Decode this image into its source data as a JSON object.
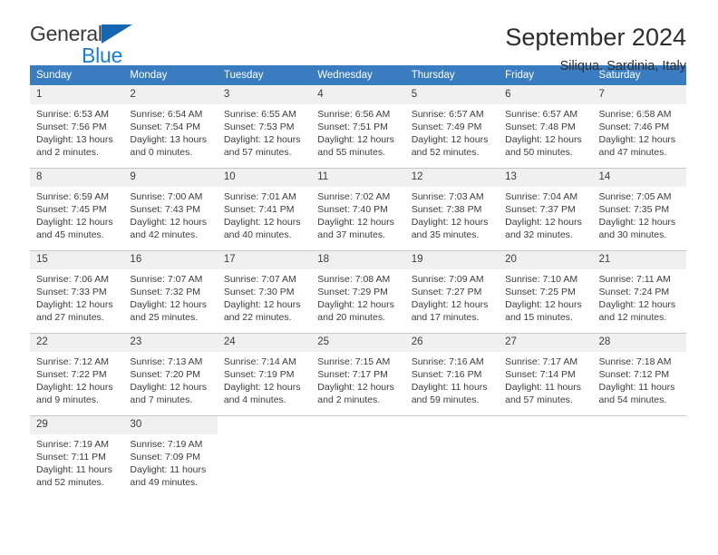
{
  "brand": {
    "name_part1": "General",
    "name_part2": "Blue",
    "triangle_color": "#1466b0",
    "blue_color": "#1a7fd4"
  },
  "header": {
    "title": "September 2024",
    "subtitle": "Siliqua, Sardinia, Italy"
  },
  "theme": {
    "header_bg": "#3a7cc0",
    "header_text": "#ffffff",
    "daynum_bg": "#f0f0f0",
    "cell_bg": "#ffffff",
    "row_border": "#c8c8c8",
    "text": "#3c3c3c"
  },
  "weekdays": [
    "Sunday",
    "Monday",
    "Tuesday",
    "Wednesday",
    "Thursday",
    "Friday",
    "Saturday"
  ],
  "weeks": [
    [
      {
        "day": "1",
        "sunrise": "Sunrise: 6:53 AM",
        "sunset": "Sunset: 7:56 PM",
        "daylight_line1": "Daylight: 13 hours",
        "daylight_line2": "and 2 minutes."
      },
      {
        "day": "2",
        "sunrise": "Sunrise: 6:54 AM",
        "sunset": "Sunset: 7:54 PM",
        "daylight_line1": "Daylight: 13 hours",
        "daylight_line2": "and 0 minutes."
      },
      {
        "day": "3",
        "sunrise": "Sunrise: 6:55 AM",
        "sunset": "Sunset: 7:53 PM",
        "daylight_line1": "Daylight: 12 hours",
        "daylight_line2": "and 57 minutes."
      },
      {
        "day": "4",
        "sunrise": "Sunrise: 6:56 AM",
        "sunset": "Sunset: 7:51 PM",
        "daylight_line1": "Daylight: 12 hours",
        "daylight_line2": "and 55 minutes."
      },
      {
        "day": "5",
        "sunrise": "Sunrise: 6:57 AM",
        "sunset": "Sunset: 7:49 PM",
        "daylight_line1": "Daylight: 12 hours",
        "daylight_line2": "and 52 minutes."
      },
      {
        "day": "6",
        "sunrise": "Sunrise: 6:57 AM",
        "sunset": "Sunset: 7:48 PM",
        "daylight_line1": "Daylight: 12 hours",
        "daylight_line2": "and 50 minutes."
      },
      {
        "day": "7",
        "sunrise": "Sunrise: 6:58 AM",
        "sunset": "Sunset: 7:46 PM",
        "daylight_line1": "Daylight: 12 hours",
        "daylight_line2": "and 47 minutes."
      }
    ],
    [
      {
        "day": "8",
        "sunrise": "Sunrise: 6:59 AM",
        "sunset": "Sunset: 7:45 PM",
        "daylight_line1": "Daylight: 12 hours",
        "daylight_line2": "and 45 minutes."
      },
      {
        "day": "9",
        "sunrise": "Sunrise: 7:00 AM",
        "sunset": "Sunset: 7:43 PM",
        "daylight_line1": "Daylight: 12 hours",
        "daylight_line2": "and 42 minutes."
      },
      {
        "day": "10",
        "sunrise": "Sunrise: 7:01 AM",
        "sunset": "Sunset: 7:41 PM",
        "daylight_line1": "Daylight: 12 hours",
        "daylight_line2": "and 40 minutes."
      },
      {
        "day": "11",
        "sunrise": "Sunrise: 7:02 AM",
        "sunset": "Sunset: 7:40 PM",
        "daylight_line1": "Daylight: 12 hours",
        "daylight_line2": "and 37 minutes."
      },
      {
        "day": "12",
        "sunrise": "Sunrise: 7:03 AM",
        "sunset": "Sunset: 7:38 PM",
        "daylight_line1": "Daylight: 12 hours",
        "daylight_line2": "and 35 minutes."
      },
      {
        "day": "13",
        "sunrise": "Sunrise: 7:04 AM",
        "sunset": "Sunset: 7:37 PM",
        "daylight_line1": "Daylight: 12 hours",
        "daylight_line2": "and 32 minutes."
      },
      {
        "day": "14",
        "sunrise": "Sunrise: 7:05 AM",
        "sunset": "Sunset: 7:35 PM",
        "daylight_line1": "Daylight: 12 hours",
        "daylight_line2": "and 30 minutes."
      }
    ],
    [
      {
        "day": "15",
        "sunrise": "Sunrise: 7:06 AM",
        "sunset": "Sunset: 7:33 PM",
        "daylight_line1": "Daylight: 12 hours",
        "daylight_line2": "and 27 minutes."
      },
      {
        "day": "16",
        "sunrise": "Sunrise: 7:07 AM",
        "sunset": "Sunset: 7:32 PM",
        "daylight_line1": "Daylight: 12 hours",
        "daylight_line2": "and 25 minutes."
      },
      {
        "day": "17",
        "sunrise": "Sunrise: 7:07 AM",
        "sunset": "Sunset: 7:30 PM",
        "daylight_line1": "Daylight: 12 hours",
        "daylight_line2": "and 22 minutes."
      },
      {
        "day": "18",
        "sunrise": "Sunrise: 7:08 AM",
        "sunset": "Sunset: 7:29 PM",
        "daylight_line1": "Daylight: 12 hours",
        "daylight_line2": "and 20 minutes."
      },
      {
        "day": "19",
        "sunrise": "Sunrise: 7:09 AM",
        "sunset": "Sunset: 7:27 PM",
        "daylight_line1": "Daylight: 12 hours",
        "daylight_line2": "and 17 minutes."
      },
      {
        "day": "20",
        "sunrise": "Sunrise: 7:10 AM",
        "sunset": "Sunset: 7:25 PM",
        "daylight_line1": "Daylight: 12 hours",
        "daylight_line2": "and 15 minutes."
      },
      {
        "day": "21",
        "sunrise": "Sunrise: 7:11 AM",
        "sunset": "Sunset: 7:24 PM",
        "daylight_line1": "Daylight: 12 hours",
        "daylight_line2": "and 12 minutes."
      }
    ],
    [
      {
        "day": "22",
        "sunrise": "Sunrise: 7:12 AM",
        "sunset": "Sunset: 7:22 PM",
        "daylight_line1": "Daylight: 12 hours",
        "daylight_line2": "and 9 minutes."
      },
      {
        "day": "23",
        "sunrise": "Sunrise: 7:13 AM",
        "sunset": "Sunset: 7:20 PM",
        "daylight_line1": "Daylight: 12 hours",
        "daylight_line2": "and 7 minutes."
      },
      {
        "day": "24",
        "sunrise": "Sunrise: 7:14 AM",
        "sunset": "Sunset: 7:19 PM",
        "daylight_line1": "Daylight: 12 hours",
        "daylight_line2": "and 4 minutes."
      },
      {
        "day": "25",
        "sunrise": "Sunrise: 7:15 AM",
        "sunset": "Sunset: 7:17 PM",
        "daylight_line1": "Daylight: 12 hours",
        "daylight_line2": "and 2 minutes."
      },
      {
        "day": "26",
        "sunrise": "Sunrise: 7:16 AM",
        "sunset": "Sunset: 7:16 PM",
        "daylight_line1": "Daylight: 11 hours",
        "daylight_line2": "and 59 minutes."
      },
      {
        "day": "27",
        "sunrise": "Sunrise: 7:17 AM",
        "sunset": "Sunset: 7:14 PM",
        "daylight_line1": "Daylight: 11 hours",
        "daylight_line2": "and 57 minutes."
      },
      {
        "day": "28",
        "sunrise": "Sunrise: 7:18 AM",
        "sunset": "Sunset: 7:12 PM",
        "daylight_line1": "Daylight: 11 hours",
        "daylight_line2": "and 54 minutes."
      }
    ],
    [
      {
        "day": "29",
        "sunrise": "Sunrise: 7:19 AM",
        "sunset": "Sunset: 7:11 PM",
        "daylight_line1": "Daylight: 11 hours",
        "daylight_line2": "and 52 minutes."
      },
      {
        "day": "30",
        "sunrise": "Sunrise: 7:19 AM",
        "sunset": "Sunset: 7:09 PM",
        "daylight_line1": "Daylight: 11 hours",
        "daylight_line2": "and 49 minutes."
      },
      {
        "day": "",
        "sunrise": "",
        "sunset": "",
        "daylight_line1": "",
        "daylight_line2": ""
      },
      {
        "day": "",
        "sunrise": "",
        "sunset": "",
        "daylight_line1": "",
        "daylight_line2": ""
      },
      {
        "day": "",
        "sunrise": "",
        "sunset": "",
        "daylight_line1": "",
        "daylight_line2": ""
      },
      {
        "day": "",
        "sunrise": "",
        "sunset": "",
        "daylight_line1": "",
        "daylight_line2": ""
      },
      {
        "day": "",
        "sunrise": "",
        "sunset": "",
        "daylight_line1": "",
        "daylight_line2": ""
      }
    ]
  ]
}
